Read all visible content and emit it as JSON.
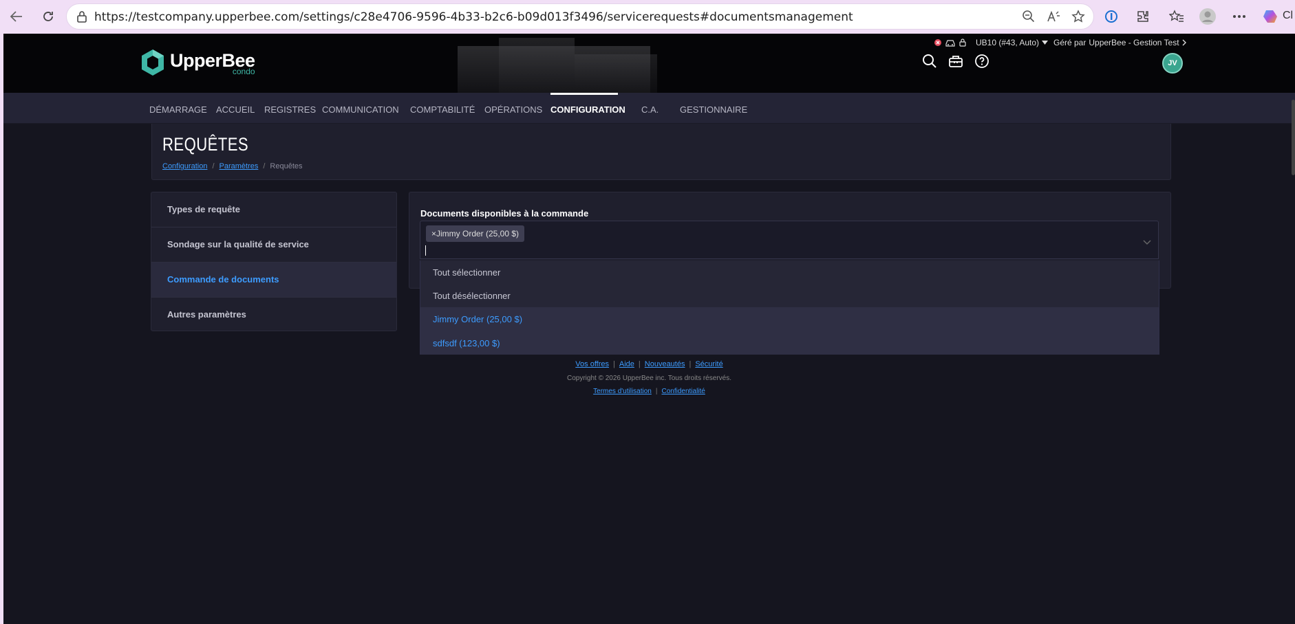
{
  "browser": {
    "url": "https://testcompany.upperbee.com/settings/c28e4706-9596-4b33-b2c6-b09d013f3496/servicerequests#documentsmanagement",
    "edge_label": "Cl"
  },
  "header": {
    "logo_name": "UpperBee",
    "logo_sub": "condo",
    "unit_selector": "UB10 (#43, Auto)",
    "managed_by_prefix": "Géré par",
    "managed_by": "UpperBee - Gestion Test",
    "avatar_initials": "JV"
  },
  "nav": {
    "items": [
      {
        "label": "Démarrage"
      },
      {
        "label": "Accueil"
      },
      {
        "label": "Registres"
      },
      {
        "label": "Communication"
      },
      {
        "label": "Comptabilité"
      },
      {
        "label": "Opérations"
      },
      {
        "label": "Configuration",
        "active": true
      },
      {
        "label": "C.A."
      },
      {
        "label": "Gestionnaire"
      }
    ]
  },
  "page": {
    "title": "REQUÊTES",
    "breadcrumb": [
      "Configuration",
      "Paramètres",
      "Requêtes"
    ]
  },
  "sidebar": {
    "items": [
      {
        "label": "Types de requête"
      },
      {
        "label": "Sondage sur la qualité de service"
      },
      {
        "label": "Commande de documents",
        "active": true
      },
      {
        "label": "Autres paramètres"
      }
    ]
  },
  "form": {
    "label": "Documents disponibles à la commande",
    "selected_tag": "×Jimmy Order (25,00 $)",
    "input_value": ""
  },
  "dropdown": {
    "options": [
      {
        "label": "Tout sélectionner"
      },
      {
        "label": "Tout désélectionner"
      },
      {
        "label": "Jimmy Order (25,00 $)",
        "selected": true
      },
      {
        "label": "sdfsdf (123,00 $)",
        "selected": true
      }
    ]
  },
  "footer": {
    "links1": [
      "Vos offres",
      "Aide",
      "Nouveautés",
      "Sécurité"
    ],
    "copyright": "Copyright © 2026 UpperBee inc. Tous droits réservés.",
    "links2": [
      "Termes d'utilisation",
      "Confidentialité"
    ]
  },
  "colors": {
    "accent": "#3d9cff",
    "brand": "#3fb7a6",
    "background": "#15151f"
  }
}
